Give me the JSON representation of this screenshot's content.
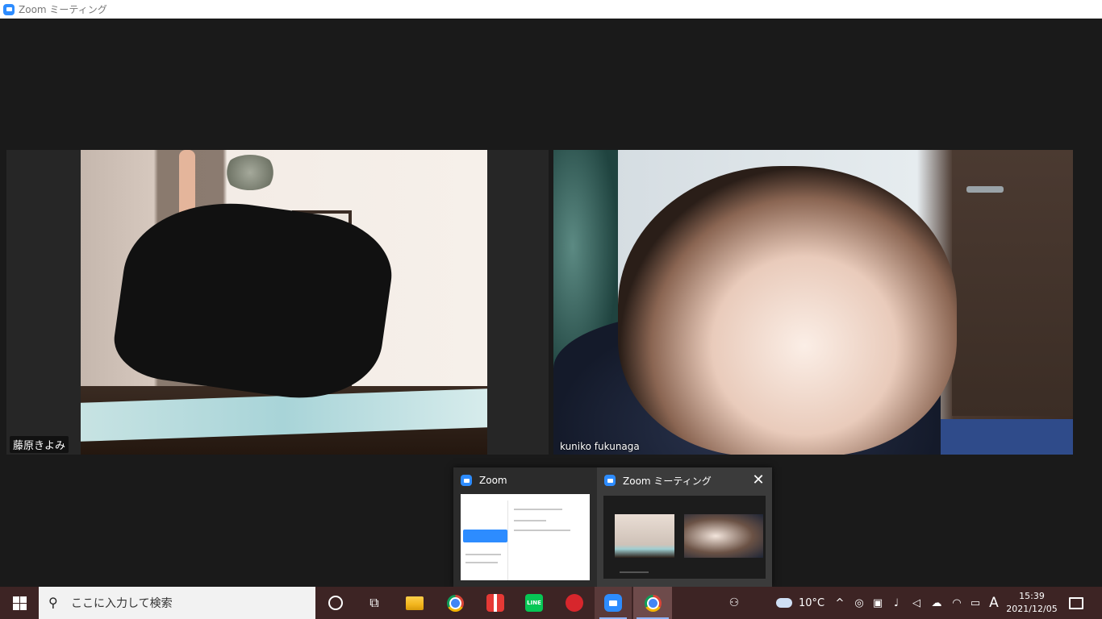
{
  "window": {
    "title": "Zoom ミーティング"
  },
  "participants": [
    {
      "name": "藤原きよみ"
    },
    {
      "name": "kuniko fukunaga"
    }
  ],
  "switcher": {
    "windows": [
      {
        "label": "Zoom"
      },
      {
        "label": "Zoom ミーティング"
      }
    ]
  },
  "taskbar": {
    "search_placeholder": "ここに入力して検索",
    "line_label": "LINE",
    "weather": "10°C",
    "ime": "A",
    "time": "15:39",
    "date": "2021/12/05"
  },
  "colors": {
    "zoom_blue": "#2d8cff",
    "taskbar": "#3d2424"
  }
}
